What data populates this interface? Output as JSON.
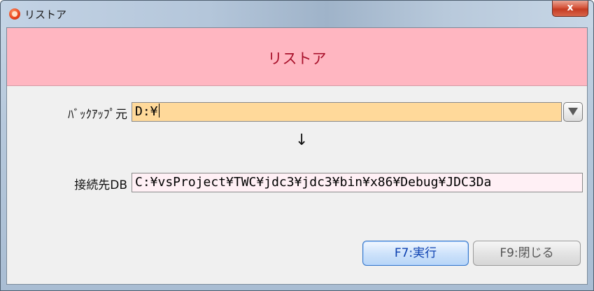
{
  "window": {
    "title": "リストア",
    "close_label": "x"
  },
  "header": {
    "title": "リストア"
  },
  "form": {
    "source_label": "ﾊﾞｯｸｱｯﾌﾟ元",
    "source_value": "D:¥",
    "arrow": "↓",
    "target_label": "接続先DB",
    "target_value": "C:¥vsProject¥TWC¥jdc3¥jdc3¥bin¥x86¥Debug¥JDC3Da"
  },
  "buttons": {
    "run_label": "F7:実行",
    "close_label": "F9:閉じる"
  },
  "colors": {
    "header_band": "#ffb6c1",
    "header_text": "#a8102a",
    "source_field": "#ffd99a",
    "target_field": "#fff0f5",
    "run_button_text": "#0a3fb0"
  }
}
